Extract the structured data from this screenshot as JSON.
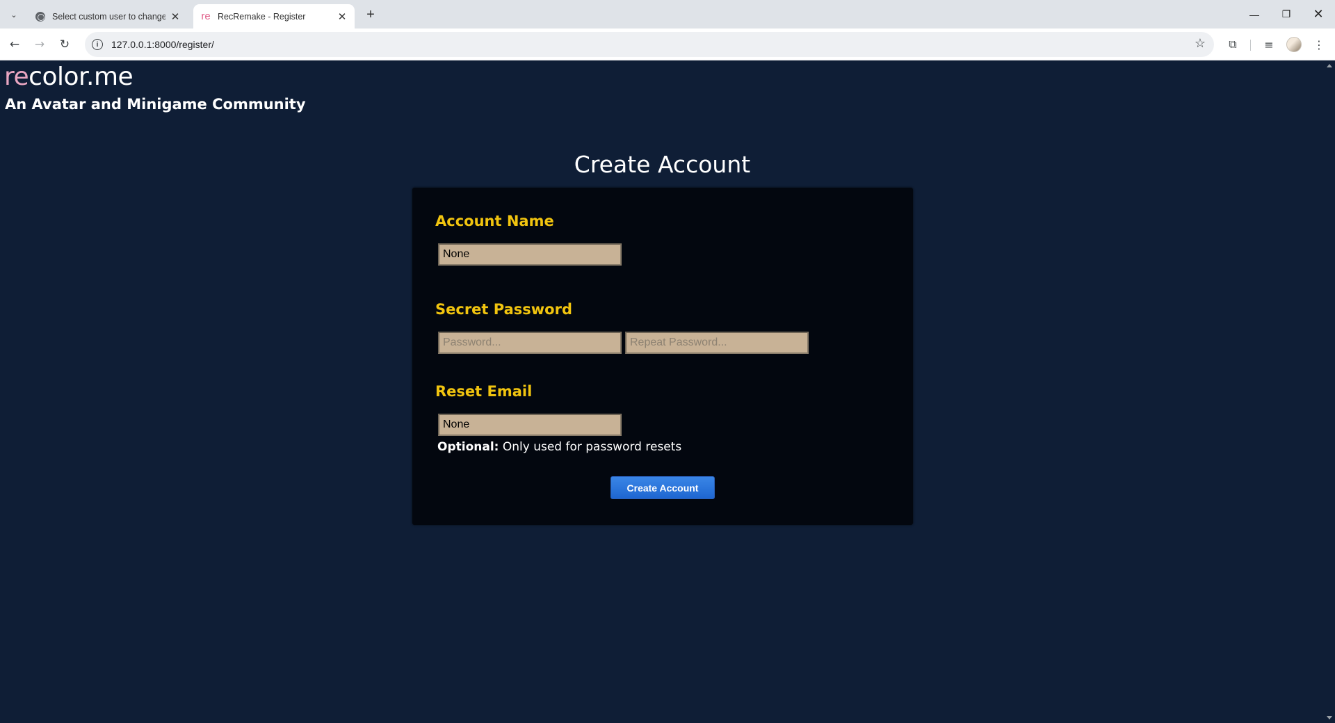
{
  "browser": {
    "tabs": [
      {
        "title": "Select custom user to change | Django site admin",
        "active": false
      },
      {
        "title": "RecRemake - Register",
        "active": true,
        "favicon_text": "re"
      }
    ],
    "address": "127.0.0.1:8000/register/"
  },
  "site": {
    "logo_prefix": "re",
    "logo_suffix": "color.me",
    "tagline": "An Avatar and Minigame Community"
  },
  "form": {
    "heading": "Create Account",
    "account_name": {
      "label": "Account Name",
      "value": "None"
    },
    "password": {
      "label": "Secret Password",
      "placeholder": "Password...",
      "repeat_placeholder": "Repeat Password..."
    },
    "email": {
      "label": "Reset Email",
      "value": "None",
      "note_strong": "Optional:",
      "note_text": " Only used for password resets"
    },
    "submit_label": "Create Account"
  },
  "colors": {
    "page_bg": "#0f1e36",
    "panel_bg": "#03070f",
    "label_yellow": "#f1c40f",
    "field_bg": "#c8b296",
    "button_blue": "#1e66d1",
    "logo_pink": "#e9a6c2"
  }
}
